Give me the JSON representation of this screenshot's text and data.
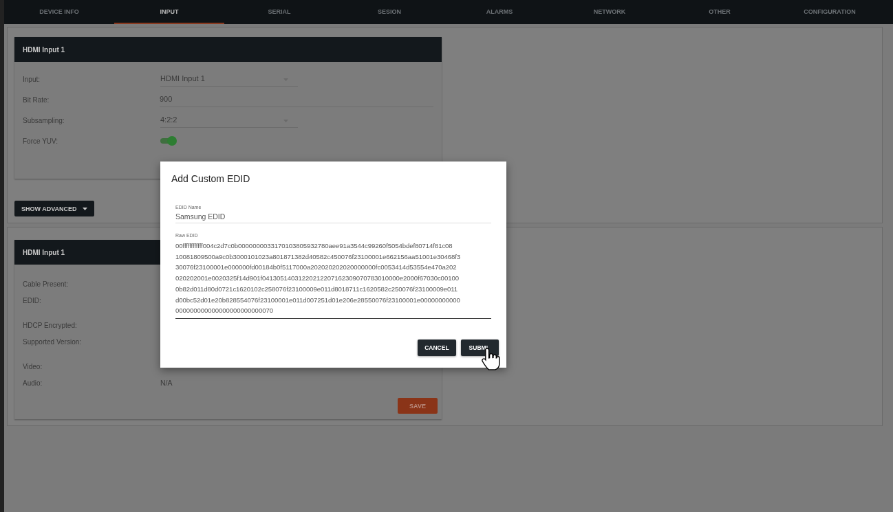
{
  "tabs": [
    {
      "label": "DEVICE INFO",
      "selected": false
    },
    {
      "label": "INPUT",
      "selected": true
    },
    {
      "label": "SERIAL",
      "selected": false
    },
    {
      "label": "SESION",
      "selected": false
    },
    {
      "label": "ALARMS",
      "selected": false
    },
    {
      "label": "NETWORK",
      "selected": false
    },
    {
      "label": "OTHER",
      "selected": false
    },
    {
      "label": "CONFIGURATION",
      "selected": false
    }
  ],
  "input_card": {
    "title": "HDMI Input 1",
    "fields": [
      {
        "kind": "select",
        "label": "Input:",
        "value": "HDMI Input 1"
      },
      {
        "kind": "text",
        "label": "Bit Rate:",
        "value": "900"
      },
      {
        "kind": "select",
        "label": "Subsampling:",
        "value": "4:2:2"
      },
      {
        "kind": "switch",
        "label": "Force YUV:",
        "on": true
      }
    ]
  },
  "show_advanced_button": "SHOW ADVANCED",
  "status_card": {
    "title": "HDMI Input 1",
    "rows": [
      {
        "label": "Cable Present:"
      },
      {
        "label": "EDID:",
        "gap_after": true
      },
      {
        "label": "HDCP Encrypted:"
      },
      {
        "label": "Supported Version:",
        "gap_after": true
      },
      {
        "label": "Video:"
      },
      {
        "label": "Audio:",
        "value": "N/A"
      }
    ],
    "save_button": "SAVE"
  },
  "dialog": {
    "title": "Add Custom EDID",
    "name_field": {
      "label": "EDID Name",
      "value": "Samsung EDID"
    },
    "raw_field": {
      "label": "Raw EDID",
      "value_lines": [
        "00ffffffffffff004c2d7c0b0000000033170103805932780aee91a3544c99260f5054bdef80714f81c08",
        "10081809500a9c0b3000101023a801871382d40582c450076f23100001e662156aa51001e30468f3",
        "30076f23100001e000000fd00184b0f5117000a202020202020000000fc0053414d53554e470a202",
        "020202001e0020325f14d901f04130514031220212207162309070783010000e2000f67030c00100",
        "0b82d011d80d0721c1620102c258076f23100009e011d8018711c1620582c250076f23100009e011",
        "d00bc52d01e20b828554076f23100001e011d007251d01e206e28550076f23100001e00000000000",
        "000000000000000000000000070"
      ]
    },
    "buttons": [
      {
        "kind": "cancel",
        "label": "CANCEL"
      },
      {
        "kind": "submit",
        "label": "SUBMI"
      }
    ]
  }
}
